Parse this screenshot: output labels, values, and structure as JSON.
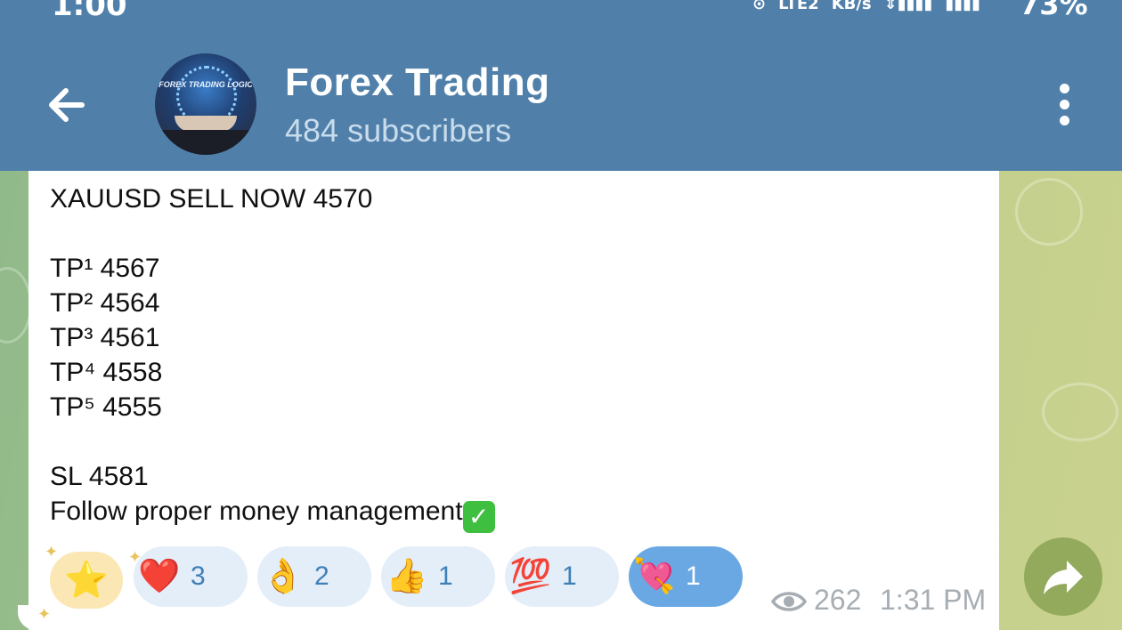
{
  "status_bar": {
    "time": "1:00",
    "network": "LTE2",
    "speed_unit": "KB/s",
    "battery": "73%"
  },
  "header": {
    "channel_title": "Forex Trading",
    "subscribers": "484 subscribers",
    "avatar_text": "FOREX TRADING LOGIC",
    "back_icon": "arrow-left-icon",
    "menu_icon": "more-vert-icon"
  },
  "message": {
    "lines": [
      "XAUUSD SELL NOW 4570",
      "TP¹ 4567",
      "TP² 4564",
      "TP³ 4561",
      "TP⁴ 4558",
      "TP⁵ 4555",
      "SL   4581",
      "Follow proper money management"
    ],
    "trailing_emoji": "✅"
  },
  "reactions": [
    {
      "emoji": "⭐",
      "count": ""
    },
    {
      "emoji": "❤️",
      "count": "3"
    },
    {
      "emoji": "👌",
      "count": "2"
    },
    {
      "emoji": "👍",
      "count": "1"
    },
    {
      "emoji": "💯",
      "count": "1"
    },
    {
      "emoji": "💘",
      "count": "1"
    }
  ],
  "meta": {
    "views": "262",
    "time": "1:31 PM"
  },
  "colors": {
    "header": "#5080aa",
    "reaction_bg": "#e3eef8",
    "reaction_selected": "#6aa8e4",
    "count_text": "#3f7fb7",
    "share_button": "#93aa5c"
  }
}
